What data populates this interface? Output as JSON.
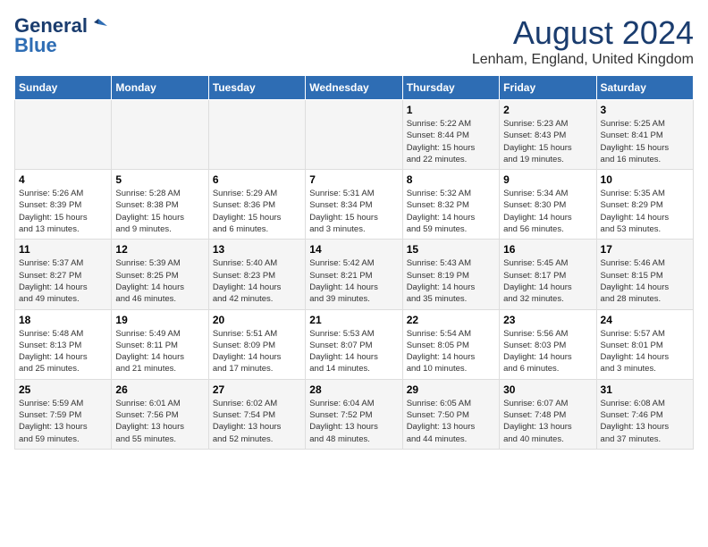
{
  "header": {
    "logo_line1": "General",
    "logo_line2": "Blue",
    "month_year": "August 2024",
    "location": "Lenham, England, United Kingdom"
  },
  "days_of_week": [
    "Sunday",
    "Monday",
    "Tuesday",
    "Wednesday",
    "Thursday",
    "Friday",
    "Saturday"
  ],
  "weeks": [
    [
      {
        "day": "",
        "content": ""
      },
      {
        "day": "",
        "content": ""
      },
      {
        "day": "",
        "content": ""
      },
      {
        "day": "",
        "content": ""
      },
      {
        "day": "1",
        "content": "Sunrise: 5:22 AM\nSunset: 8:44 PM\nDaylight: 15 hours\nand 22 minutes."
      },
      {
        "day": "2",
        "content": "Sunrise: 5:23 AM\nSunset: 8:43 PM\nDaylight: 15 hours\nand 19 minutes."
      },
      {
        "day": "3",
        "content": "Sunrise: 5:25 AM\nSunset: 8:41 PM\nDaylight: 15 hours\nand 16 minutes."
      }
    ],
    [
      {
        "day": "4",
        "content": "Sunrise: 5:26 AM\nSunset: 8:39 PM\nDaylight: 15 hours\nand 13 minutes."
      },
      {
        "day": "5",
        "content": "Sunrise: 5:28 AM\nSunset: 8:38 PM\nDaylight: 15 hours\nand 9 minutes."
      },
      {
        "day": "6",
        "content": "Sunrise: 5:29 AM\nSunset: 8:36 PM\nDaylight: 15 hours\nand 6 minutes."
      },
      {
        "day": "7",
        "content": "Sunrise: 5:31 AM\nSunset: 8:34 PM\nDaylight: 15 hours\nand 3 minutes."
      },
      {
        "day": "8",
        "content": "Sunrise: 5:32 AM\nSunset: 8:32 PM\nDaylight: 14 hours\nand 59 minutes."
      },
      {
        "day": "9",
        "content": "Sunrise: 5:34 AM\nSunset: 8:30 PM\nDaylight: 14 hours\nand 56 minutes."
      },
      {
        "day": "10",
        "content": "Sunrise: 5:35 AM\nSunset: 8:29 PM\nDaylight: 14 hours\nand 53 minutes."
      }
    ],
    [
      {
        "day": "11",
        "content": "Sunrise: 5:37 AM\nSunset: 8:27 PM\nDaylight: 14 hours\nand 49 minutes."
      },
      {
        "day": "12",
        "content": "Sunrise: 5:39 AM\nSunset: 8:25 PM\nDaylight: 14 hours\nand 46 minutes."
      },
      {
        "day": "13",
        "content": "Sunrise: 5:40 AM\nSunset: 8:23 PM\nDaylight: 14 hours\nand 42 minutes."
      },
      {
        "day": "14",
        "content": "Sunrise: 5:42 AM\nSunset: 8:21 PM\nDaylight: 14 hours\nand 39 minutes."
      },
      {
        "day": "15",
        "content": "Sunrise: 5:43 AM\nSunset: 8:19 PM\nDaylight: 14 hours\nand 35 minutes."
      },
      {
        "day": "16",
        "content": "Sunrise: 5:45 AM\nSunset: 8:17 PM\nDaylight: 14 hours\nand 32 minutes."
      },
      {
        "day": "17",
        "content": "Sunrise: 5:46 AM\nSunset: 8:15 PM\nDaylight: 14 hours\nand 28 minutes."
      }
    ],
    [
      {
        "day": "18",
        "content": "Sunrise: 5:48 AM\nSunset: 8:13 PM\nDaylight: 14 hours\nand 25 minutes."
      },
      {
        "day": "19",
        "content": "Sunrise: 5:49 AM\nSunset: 8:11 PM\nDaylight: 14 hours\nand 21 minutes."
      },
      {
        "day": "20",
        "content": "Sunrise: 5:51 AM\nSunset: 8:09 PM\nDaylight: 14 hours\nand 17 minutes."
      },
      {
        "day": "21",
        "content": "Sunrise: 5:53 AM\nSunset: 8:07 PM\nDaylight: 14 hours\nand 14 minutes."
      },
      {
        "day": "22",
        "content": "Sunrise: 5:54 AM\nSunset: 8:05 PM\nDaylight: 14 hours\nand 10 minutes."
      },
      {
        "day": "23",
        "content": "Sunrise: 5:56 AM\nSunset: 8:03 PM\nDaylight: 14 hours\nand 6 minutes."
      },
      {
        "day": "24",
        "content": "Sunrise: 5:57 AM\nSunset: 8:01 PM\nDaylight: 14 hours\nand 3 minutes."
      }
    ],
    [
      {
        "day": "25",
        "content": "Sunrise: 5:59 AM\nSunset: 7:59 PM\nDaylight: 13 hours\nand 59 minutes."
      },
      {
        "day": "26",
        "content": "Sunrise: 6:01 AM\nSunset: 7:56 PM\nDaylight: 13 hours\nand 55 minutes."
      },
      {
        "day": "27",
        "content": "Sunrise: 6:02 AM\nSunset: 7:54 PM\nDaylight: 13 hours\nand 52 minutes."
      },
      {
        "day": "28",
        "content": "Sunrise: 6:04 AM\nSunset: 7:52 PM\nDaylight: 13 hours\nand 48 minutes."
      },
      {
        "day": "29",
        "content": "Sunrise: 6:05 AM\nSunset: 7:50 PM\nDaylight: 13 hours\nand 44 minutes."
      },
      {
        "day": "30",
        "content": "Sunrise: 6:07 AM\nSunset: 7:48 PM\nDaylight: 13 hours\nand 40 minutes."
      },
      {
        "day": "31",
        "content": "Sunrise: 6:08 AM\nSunset: 7:46 PM\nDaylight: 13 hours\nand 37 minutes."
      }
    ]
  ]
}
